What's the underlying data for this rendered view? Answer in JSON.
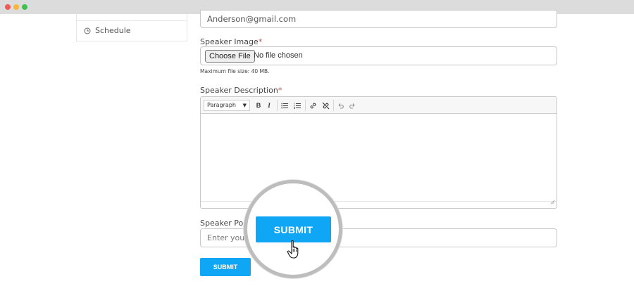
{
  "window": {
    "controls": [
      "close",
      "minimize",
      "maximize"
    ]
  },
  "sidebar": {
    "items": [
      {
        "label": "Schedule",
        "icon": "clock-icon"
      }
    ]
  },
  "form": {
    "email": {
      "value": "Anderson@gmail.com"
    },
    "speaker_image": {
      "label": "Speaker Image",
      "required_mark": "*",
      "button_label": "Choose File",
      "status": "No file chosen",
      "hint": "Maximum file size: 40 MB."
    },
    "speaker_description": {
      "label": "Speaker Description",
      "required_mark": "*",
      "toolbar": {
        "paragraph": "Paragraph",
        "bold": "B",
        "italic": "I"
      }
    },
    "speaker_position": {
      "label": "Speaker Pos",
      "placeholder": "Enter your"
    },
    "submit_label": "SUBMIT"
  },
  "magnifier": {
    "button_label": "SUBMIT"
  },
  "colors": {
    "accent": "#0ea6f5",
    "required": "#e04545"
  }
}
